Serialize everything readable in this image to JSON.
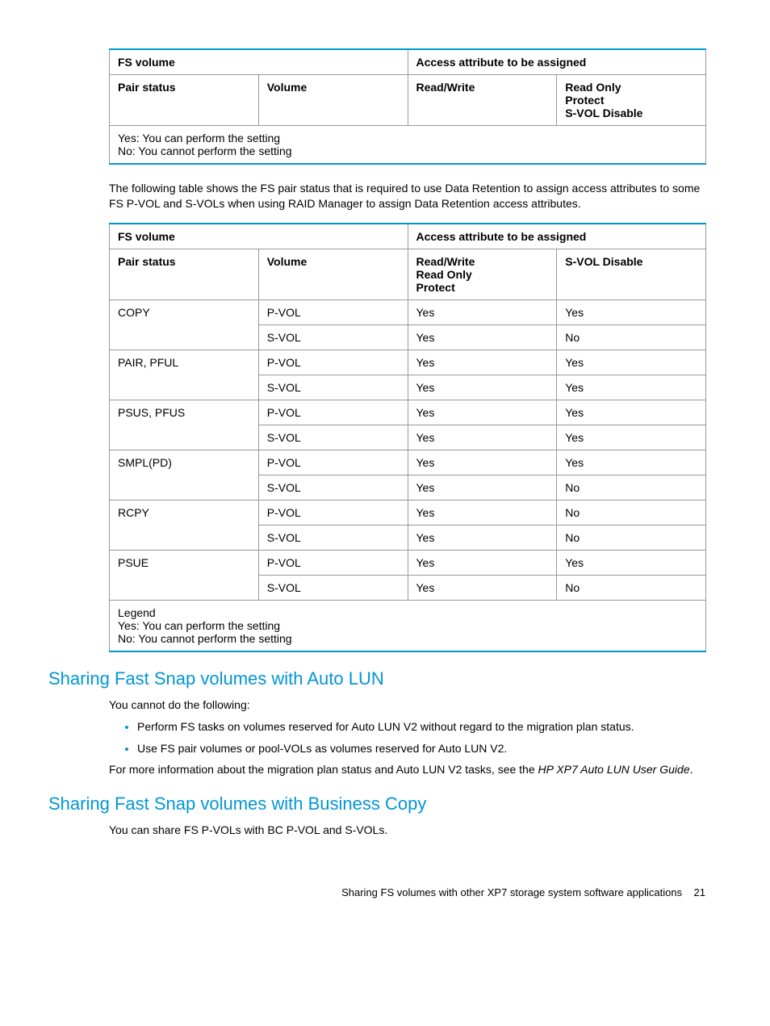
{
  "table1": {
    "head1": {
      "fs": "FS volume",
      "access": "Access attribute to be assigned"
    },
    "head2": {
      "pair": "Pair status",
      "vol": "Volume",
      "rw": "Read/Write",
      "ro": "Read Only\nProtect\nS-VOL Disable"
    },
    "legend1": "Yes: You can perform the setting",
    "legend2": "No: You cannot perform the setting"
  },
  "para1": "The following table shows the FS pair status that is required to use Data Retention to assign access attributes to some FS P-VOL and S-VOLs when using RAID Manager to assign Data Retention access attributes.",
  "table2": {
    "head1": {
      "fs": "FS volume",
      "access": "Access attribute to be assigned"
    },
    "head2": {
      "pair": "Pair status",
      "vol": "Volume",
      "rw": "Read/Write\nRead Only\nProtect",
      "svol": "S-VOL Disable"
    },
    "rows": [
      {
        "ps": "COPY",
        "v": "P-VOL",
        "a": "Yes",
        "b": "Yes"
      },
      {
        "ps": "",
        "v": "S-VOL",
        "a": "Yes",
        "b": "No"
      },
      {
        "ps": "PAIR, PFUL",
        "v": "P-VOL",
        "a": "Yes",
        "b": "Yes"
      },
      {
        "ps": "",
        "v": "S-VOL",
        "a": "Yes",
        "b": "Yes"
      },
      {
        "ps": "PSUS, PFUS",
        "v": "P-VOL",
        "a": "Yes",
        "b": "Yes"
      },
      {
        "ps": "",
        "v": "S-VOL",
        "a": "Yes",
        "b": "Yes"
      },
      {
        "ps": "SMPL(PD)",
        "v": "P-VOL",
        "a": "Yes",
        "b": "Yes"
      },
      {
        "ps": "",
        "v": "S-VOL",
        "a": "Yes",
        "b": "No"
      },
      {
        "ps": "RCPY",
        "v": "P-VOL",
        "a": "Yes",
        "b": "No"
      },
      {
        "ps": "",
        "v": "S-VOL",
        "a": "Yes",
        "b": "No"
      },
      {
        "ps": "PSUE",
        "v": "P-VOL",
        "a": "Yes",
        "b": "Yes"
      },
      {
        "ps": "",
        "v": "S-VOL",
        "a": "Yes",
        "b": "No"
      }
    ],
    "legend0": "Legend",
    "legend1": "Yes: You can perform the setting",
    "legend2": "No: You cannot perform the setting"
  },
  "h2a": "Sharing Fast Snap volumes with Auto LUN",
  "p2": "You cannot do the following:",
  "li1": "Perform FS tasks on volumes reserved for Auto LUN V2 without regard to the migration plan status.",
  "li2": "Use FS pair volumes or pool-VOLs as volumes reserved for Auto LUN V2.",
  "p3a": "For more information about the migration plan status and Auto LUN V2 tasks, see the ",
  "p3b": "HP XP7 Auto LUN User Guide",
  "p3c": ".",
  "h2b": "Sharing Fast Snap volumes with Business Copy",
  "p4": "You can share FS P-VOLs with BC P-VOL and S-VOLs.",
  "footer_text": "Sharing FS volumes with other XP7 storage system software applications",
  "footer_page": "21"
}
